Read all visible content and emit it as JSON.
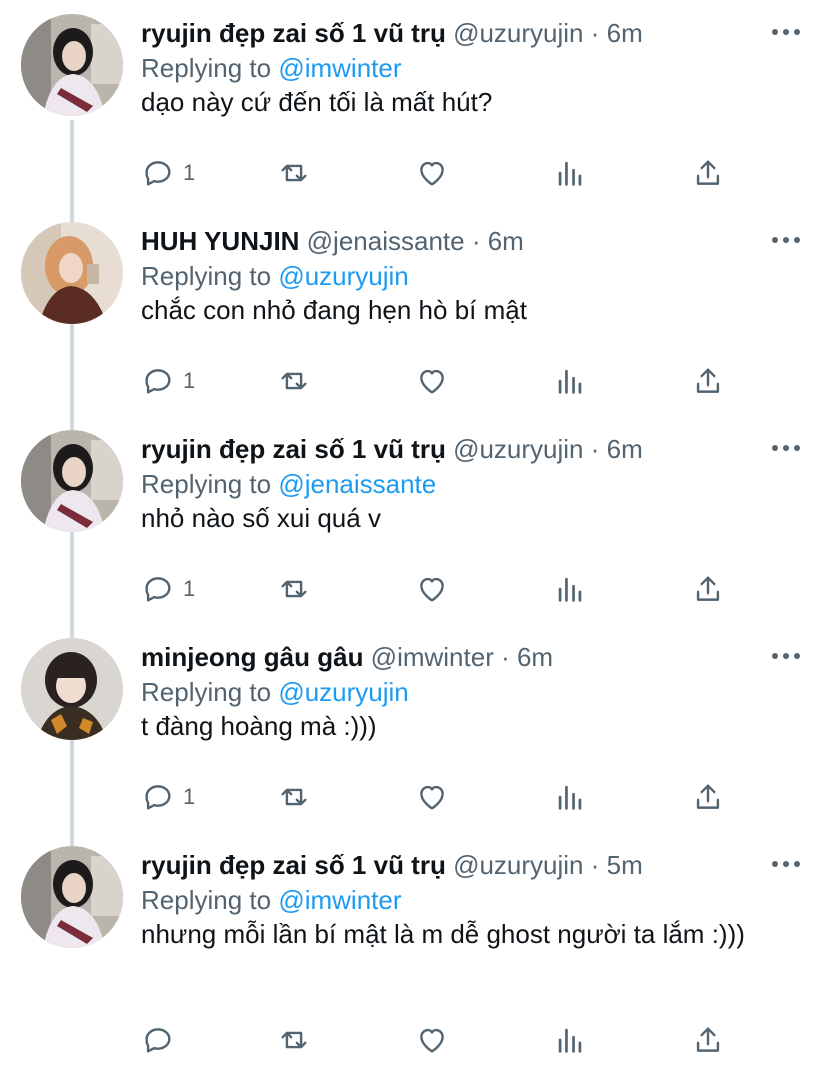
{
  "tweets": [
    {
      "name": "ryujin đẹp zai số 1 vũ trụ",
      "meta": " @uzuryujin · 6m",
      "replying_prefix": "Replying to ",
      "replying_handle": "@imwinter",
      "text": "dạo này cứ đến tối là mất hút?",
      "reply_count": "1",
      "avatar": "ryujin"
    },
    {
      "name": "HUH YUNJIN",
      "meta": " @jenaissante · 6m",
      "replying_prefix": "Replying to ",
      "replying_handle": "@uzuryujin",
      "text": "chắc con nhỏ đang hẹn hò bí mật",
      "reply_count": "1",
      "avatar": "yunjin"
    },
    {
      "name": "ryujin đẹp zai số 1 vũ trụ",
      "meta": " @uzuryujin · 6m",
      "replying_prefix": "Replying to ",
      "replying_handle": "@jenaissante",
      "text": "nhỏ nào số xui quá v",
      "reply_count": "1",
      "avatar": "ryujin"
    },
    {
      "name": "minjeong gâu gâu",
      "meta": " @imwinter · 6m",
      "replying_prefix": "Replying to ",
      "replying_handle": "@uzuryujin",
      "text": "t đàng hoàng mà :)))",
      "reply_count": "1",
      "avatar": "minjeong"
    },
    {
      "name": "ryujin đẹp zai số 1 vũ trụ",
      "meta": " @uzuryujin · 5m",
      "replying_prefix": "Replying to ",
      "replying_handle": "@imwinter",
      "text": "nhưng mỗi lần bí mật là m dễ ghost người ta lắm :)))",
      "reply_count": "",
      "avatar": "ryujin"
    }
  ],
  "colors": {
    "text_primary": "#0f1419",
    "text_secondary": "#536471",
    "link": "#1d9bf0",
    "thread_line": "#cfd9de"
  }
}
